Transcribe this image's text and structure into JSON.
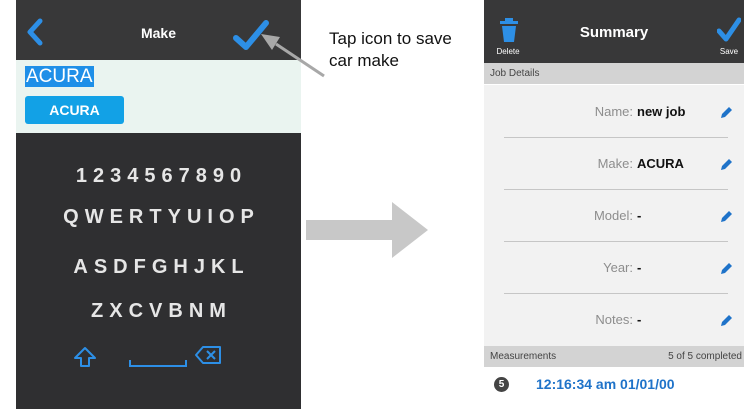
{
  "left_screen": {
    "title": "Make",
    "input_value": "ACURA",
    "suggestion": "ACURA",
    "keyboard": {
      "rows": [
        [
          "1",
          "2",
          "3",
          "4",
          "5",
          "6",
          "7",
          "8",
          "9",
          "0"
        ],
        [
          "Q",
          "W",
          "E",
          "R",
          "T",
          "Y",
          "U",
          "I",
          "O",
          "P"
        ],
        [
          "A",
          "S",
          "D",
          "F",
          "G",
          "H",
          "J",
          "K",
          "L"
        ],
        [
          "Z",
          "X",
          "C",
          "V",
          "B",
          "N",
          "M"
        ]
      ]
    },
    "icons": {
      "back": "chevron-left-icon",
      "save": "checkmark-icon",
      "shift": "shift-icon",
      "space": "space-bar-icon",
      "backspace": "backspace-icon"
    }
  },
  "annotation": {
    "text": "Tap icon to save car make"
  },
  "right_screen": {
    "title": "Summary",
    "delete_label": "Delete",
    "save_label": "Save",
    "job_details_header": "Job Details",
    "fields": [
      {
        "label": "Name:",
        "value": "new job"
      },
      {
        "label": "Make:",
        "value": "ACURA"
      },
      {
        "label": "Model:",
        "value": "-"
      },
      {
        "label": "Year:",
        "value": "-"
      },
      {
        "label": "Notes:",
        "value": "-"
      }
    ],
    "measurements_header": "Measurements",
    "measurements_status": "5 of 5 completed",
    "measurement": {
      "number": "5",
      "timestamp": "12:16:34 am 01/01/00"
    }
  },
  "colors": {
    "header_bg": "#383839",
    "keyboard_bg": "#2f2f31",
    "accent_blue": "#1f8fe8",
    "timestamp_blue": "#1f73c9",
    "section_bar": "#d3d3d3"
  }
}
